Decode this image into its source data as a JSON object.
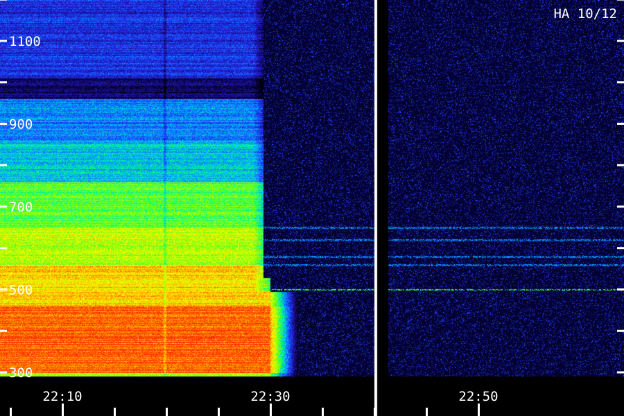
{
  "chart_data": {
    "type": "heatmap",
    "title": "HA 10/12",
    "xlabel": "",
    "ylabel": "",
    "x_axis": {
      "unit": "time",
      "range": [
        "22:04",
        "22:54"
      ],
      "tick_labels": [
        "22:10",
        "22:30",
        "22:50"
      ],
      "minor_tick_interval_minutes": 5
    },
    "y_axis": {
      "range": [
        300,
        1200
      ],
      "tick_labels": [
        "300",
        "500",
        "700",
        "900",
        "1100"
      ],
      "tick_values": [
        300,
        500,
        700,
        900,
        1100
      ],
      "minor_tick_values": [
        400,
        600,
        800,
        1000,
        1200
      ]
    },
    "colormap": [
      "#000022",
      "#1a0a8a",
      "#2233ff",
      "#00aaff",
      "#00ff88",
      "#88ff00",
      "#ffff00",
      "#ff8800",
      "#ff2200"
    ],
    "data_gap": {
      "start": "22:40",
      "end": "22:41"
    },
    "cutoff_time": "22:31",
    "grid": false,
    "legend": "none"
  }
}
